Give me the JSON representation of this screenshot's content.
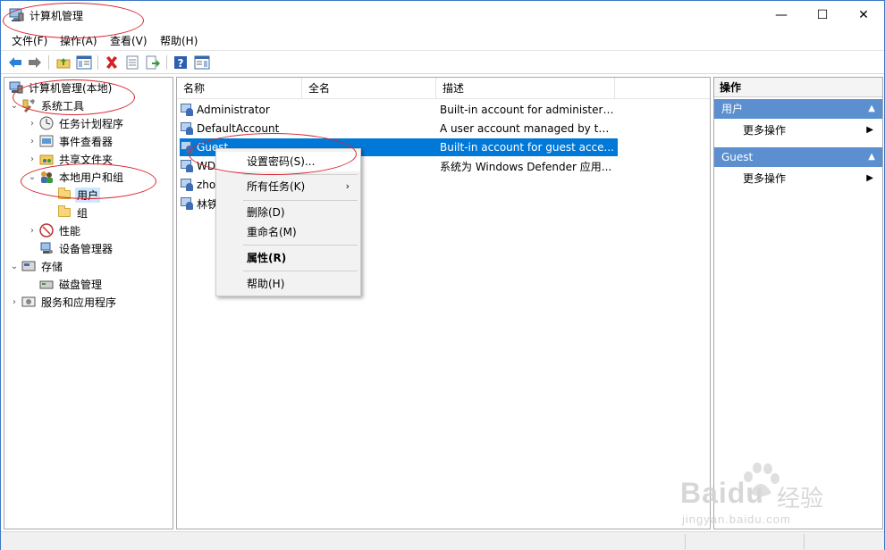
{
  "window": {
    "title": "计算机管理",
    "minimize_glyph": "—",
    "maximize_glyph": "☐",
    "close_glyph": "✕"
  },
  "menu": [
    "文件(F)",
    "操作(A)",
    "查看(V)",
    "帮助(H)"
  ],
  "toolbar": {
    "icons": [
      "back-arrow-icon",
      "forward-arrow-icon",
      "up-folder-icon",
      "show-hide-tree-icon",
      "delete-icon",
      "properties-icon",
      "export-list-icon",
      "help-icon",
      "show-hide-action-pane-icon"
    ]
  },
  "tree": {
    "root": "计算机管理(本地)",
    "system_tools": "系统工具",
    "task_scheduler": "任务计划程序",
    "event_viewer": "事件查看器",
    "shared_folders": "共享文件夹",
    "local_users_groups": "本地用户和组",
    "users": "用户",
    "groups": "组",
    "performance": "性能",
    "device_manager": "设备管理器",
    "storage": "存储",
    "disk_management": "磁盘管理",
    "services_apps": "服务和应用程序"
  },
  "list": {
    "columns": [
      "名称",
      "全名",
      "描述"
    ],
    "rows": [
      {
        "name": "Administrator",
        "desc": "Built-in account for administeri..."
      },
      {
        "name": "DefaultAccount",
        "desc": "A user account managed by th..."
      },
      {
        "name": "Guest",
        "desc": "Built-in account for guest acce..."
      },
      {
        "name": "WD",
        "desc": "系统为 Windows Defender 应用..."
      },
      {
        "name": "zho",
        "desc": ""
      },
      {
        "name": "林铁",
        "desc": ""
      }
    ]
  },
  "context_menu": {
    "set_password": "设置密码(S)...",
    "all_tasks": "所有任务(K)",
    "delete": "删除(D)",
    "rename": "重命名(M)",
    "properties": "属性(R)",
    "help": "帮助(H)",
    "submenu_glyph": "›"
  },
  "actions": {
    "title": "操作",
    "section_users": "用户",
    "more_actions_1": "更多操作",
    "section_guest": "Guest",
    "more_actions_2": "更多操作",
    "collapse_glyph": "▲",
    "more_glyph": "▶"
  },
  "watermark": {
    "brand": "Baidu",
    "brand_cn": "经验",
    "url": "jingyan.baidu.com"
  },
  "colors": {
    "selection": "#0078d7",
    "tree_selection": "#cce8ff",
    "actions_header": "#5b8fd0",
    "annotation": "#d9232e",
    "window_border": "#3b78c4"
  }
}
